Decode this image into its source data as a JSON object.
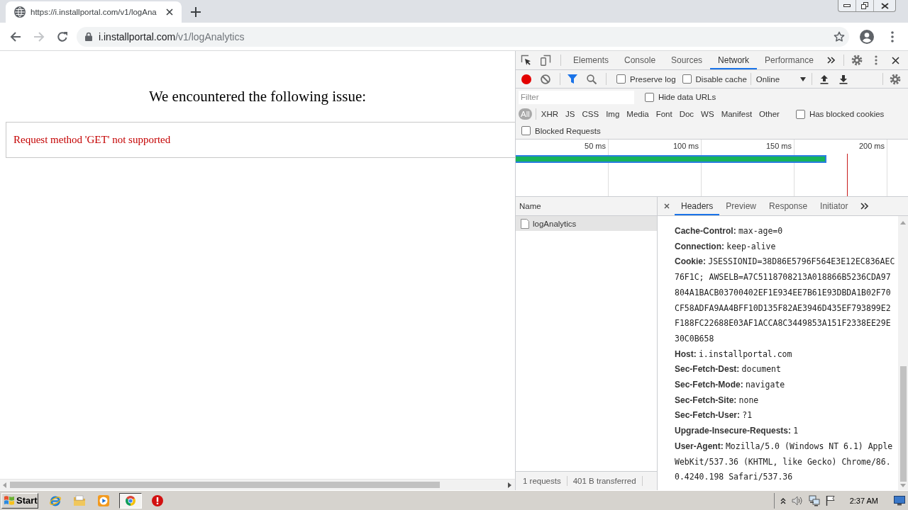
{
  "browser_tab": {
    "title": "https://i.installportal.com/v1/logAna"
  },
  "navigation": [
    {
      "kind": "back",
      "disabled": false
    },
    {
      "kind": "forward",
      "disabled": true
    },
    {
      "kind": "reload",
      "disabled": false
    }
  ],
  "address_bar": {
    "host": "i.installportal.com",
    "path": "/v1/logAnalytics"
  },
  "page": {
    "heading": "We encountered the following issue:",
    "error": "Request method 'GET' not supported"
  },
  "devtools": {
    "tabs": [
      {
        "label": "Elements",
        "selected": false
      },
      {
        "label": "Console",
        "selected": false
      },
      {
        "label": "Sources",
        "selected": false
      },
      {
        "label": "Network",
        "selected": true
      },
      {
        "label": "Performance",
        "selected": false
      }
    ],
    "recording": true,
    "options": [
      {
        "label": "Preserve log",
        "checked": false
      },
      {
        "label": "Disable cache",
        "checked": false
      }
    ],
    "throttling": "Online",
    "filter": {
      "placeholder": "Filter"
    },
    "hide_data_urls": {
      "label": "Hide data URLs",
      "checked": false
    },
    "types": [
      {
        "label": "All",
        "selected": true
      },
      {
        "label": "XHR",
        "selected": false
      },
      {
        "label": "JS",
        "selected": false
      },
      {
        "label": "CSS",
        "selected": false
      },
      {
        "label": "Img",
        "selected": false
      },
      {
        "label": "Media",
        "selected": false
      },
      {
        "label": "Font",
        "selected": false
      },
      {
        "label": "Doc",
        "selected": false
      },
      {
        "label": "WS",
        "selected": false
      },
      {
        "label": "Manifest",
        "selected": false
      },
      {
        "label": "Other",
        "selected": false
      }
    ],
    "has_blocked_cookies": {
      "label": "Has blocked cookies",
      "checked": false
    },
    "blocked_requests": {
      "label": "Blocked Requests",
      "checked": false
    },
    "timeline_ticks": [
      "50 ms",
      "100 ms",
      "150 ms",
      "200 ms"
    ],
    "requests": {
      "column": "Name",
      "rows": [
        {
          "name": "logAnalytics",
          "selected": true
        }
      ]
    },
    "summary": [
      "1 requests",
      "401 B transferred"
    ],
    "details": {
      "tabs": [
        {
          "label": "Headers",
          "selected": true
        },
        {
          "label": "Preview",
          "selected": false
        },
        {
          "label": "Response",
          "selected": false
        },
        {
          "label": "Initiator",
          "selected": false
        }
      ],
      "headers": [
        {
          "name": "Cache-Control:",
          "value": "max-age=0"
        },
        {
          "name": "Connection:",
          "value": "keep-alive"
        },
        {
          "name": "Cookie:",
          "value": "JSESSIONID=38D86E5796F564E3E12EC836AEC76F1C; AWSELB=A7C5118708213A018866B5236CDA97804A1BACB03700402EF1E934EE7B61E93DBDA1B02F70CF58ADFA9AA4BFF10D135F82AE3946D435EF793899E2F188FC22688E03AF1ACCA8C3449853A151F2338EE29E30C0B658"
        },
        {
          "name": "Host:",
          "value": "i.installportal.com"
        },
        {
          "name": "Sec-Fetch-Dest:",
          "value": "document"
        },
        {
          "name": "Sec-Fetch-Mode:",
          "value": "navigate"
        },
        {
          "name": "Sec-Fetch-Site:",
          "value": "none"
        },
        {
          "name": "Sec-Fetch-User:",
          "value": "?1"
        },
        {
          "name": "Upgrade-Insecure-Requests:",
          "value": "1"
        },
        {
          "name": "User-Agent:",
          "value": "Mozilla/5.0 (Windows NT 6.1) AppleWebKit/537.36 (KHTML, like Gecko) Chrome/86.0.4240.198 Safari/537.36"
        }
      ]
    }
  },
  "taskbar": {
    "start": "Start",
    "apps": [
      {
        "kind": "ring",
        "active": false
      },
      {
        "kind": "folder",
        "active": false
      },
      {
        "kind": "player",
        "active": false
      },
      {
        "kind": "wheel",
        "active": true
      },
      {
        "kind": "alert",
        "active": false
      }
    ],
    "clock": "2:37 AM"
  }
}
